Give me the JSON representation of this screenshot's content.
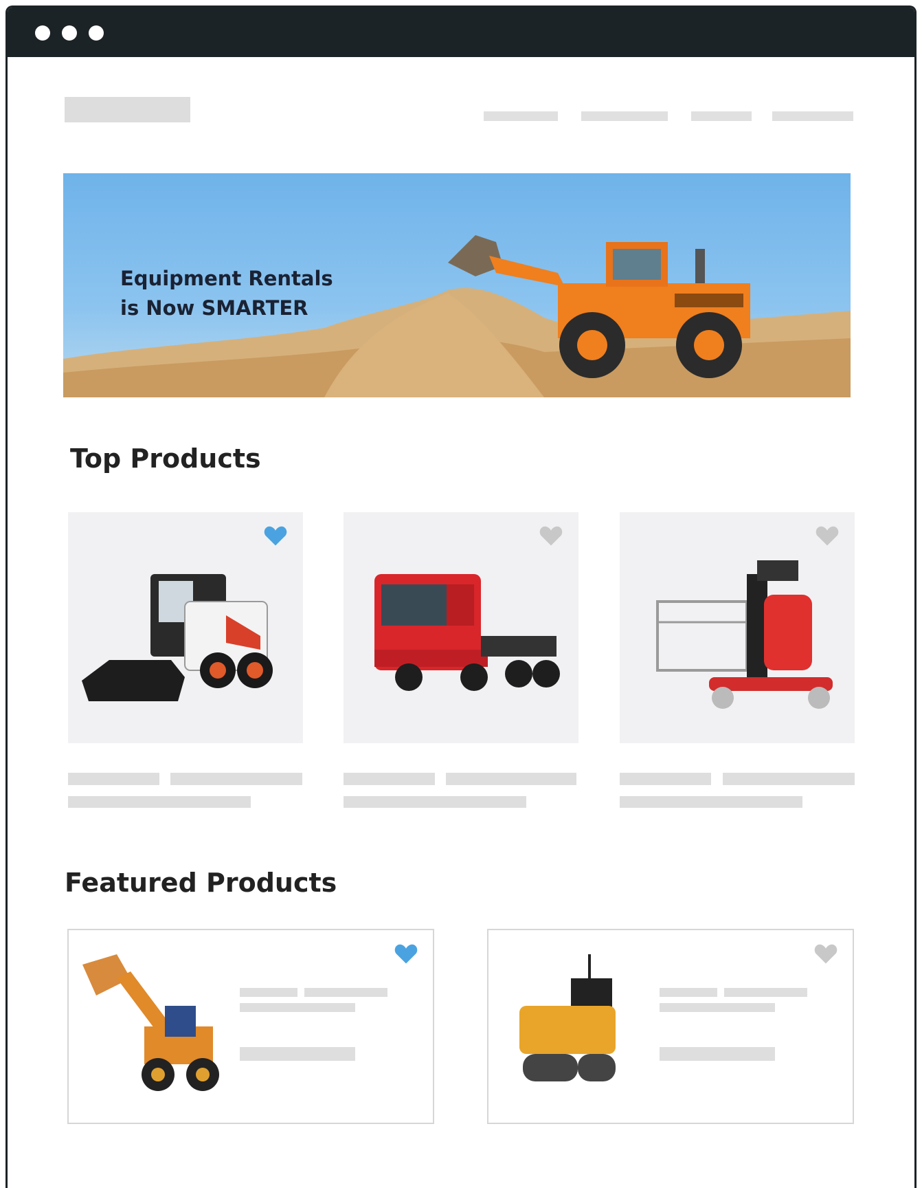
{
  "window": {
    "controls": [
      "close-dot",
      "minimize-dot",
      "maximize-dot"
    ]
  },
  "header": {
    "nav_count": 4
  },
  "hero": {
    "title_line1": "Equipment Rentals",
    "title_line2": "is Now SMARTER",
    "sky_color": "#6fb3ea",
    "loader_color": "#f07f1e"
  },
  "top_products": {
    "title": "Top Products",
    "items": [
      {
        "icon": "skid-steer-loader",
        "favorited": true
      },
      {
        "icon": "semi-truck-tractor",
        "favorited": false
      },
      {
        "icon": "vertical-mast-lift",
        "favorited": false
      }
    ]
  },
  "featured_products": {
    "title": "Featured Products",
    "items": [
      {
        "icon": "wheel-loader",
        "favorited": true
      },
      {
        "icon": "road-roller",
        "favorited": false
      }
    ]
  },
  "colors": {
    "favorite_active": "#4aa3e0",
    "favorite_inactive": "#c8c8c8",
    "placeholder": "#dedede",
    "titlebar": "#1c2326"
  }
}
